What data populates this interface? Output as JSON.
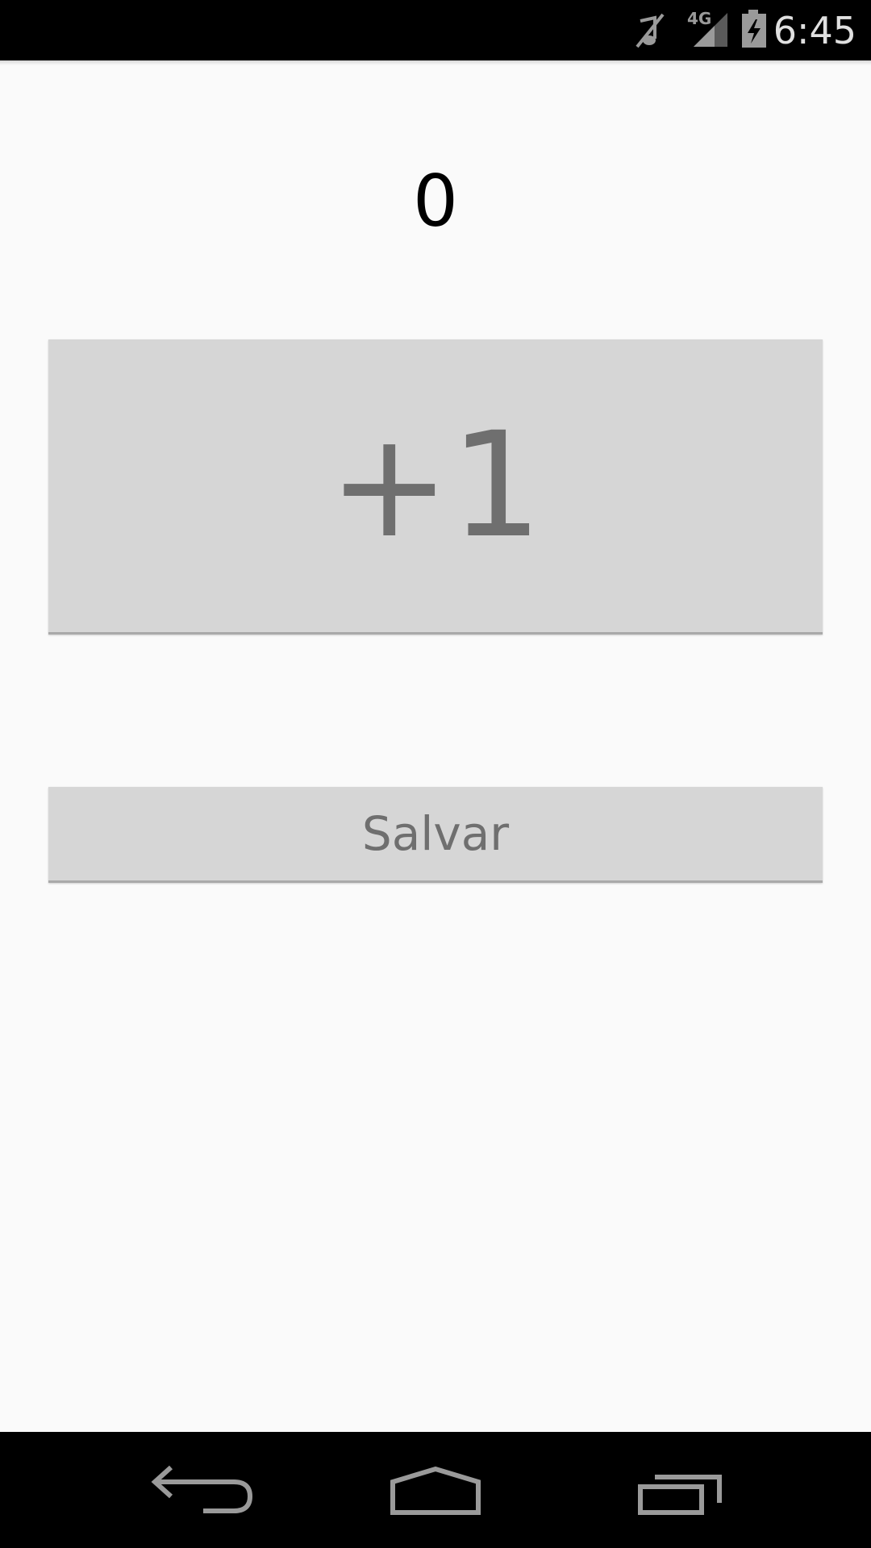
{
  "status_bar": {
    "time": "6:45",
    "network_label": "4G",
    "icons": [
      "muted-icon",
      "signal-icon",
      "battery-charging-icon"
    ]
  },
  "counter": {
    "value": "0"
  },
  "buttons": {
    "increment_label": "+1",
    "save_label": "Salvar"
  },
  "nav_bar": {
    "icons": [
      "back-icon",
      "home-icon",
      "recents-icon"
    ]
  },
  "colors": {
    "background": "#fafafa",
    "button_bg": "#d6d6d6",
    "button_text": "#6f6f6f",
    "bar_bg": "#000000",
    "icon_gray": "#9a9a9a"
  }
}
